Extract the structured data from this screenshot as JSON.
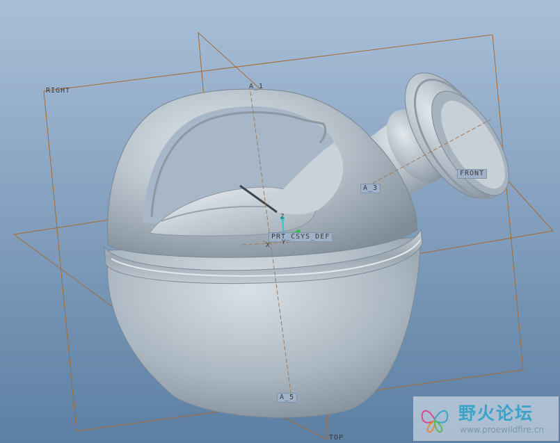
{
  "viewport": {
    "background_top": "#a9bfd8",
    "background_bottom": "#5a7ca0",
    "model_color": "#b4bec8",
    "datum_color": "#a86a30",
    "axis_color": "#a07a5a"
  },
  "datums": {
    "right": "RIGHT",
    "front": "FRONT",
    "top": "TOP",
    "axis_1": "A_1",
    "axis_3": "A_3",
    "axis_5": "A_5",
    "csys": "PRT_CSYS_DEF",
    "csys_x": "X",
    "csys_y": "Y",
    "csys_z": "Z"
  },
  "watermark": {
    "title": "野火论坛",
    "url": "www.proewildfire.cn",
    "icon": "butterfly-logo-icon"
  }
}
